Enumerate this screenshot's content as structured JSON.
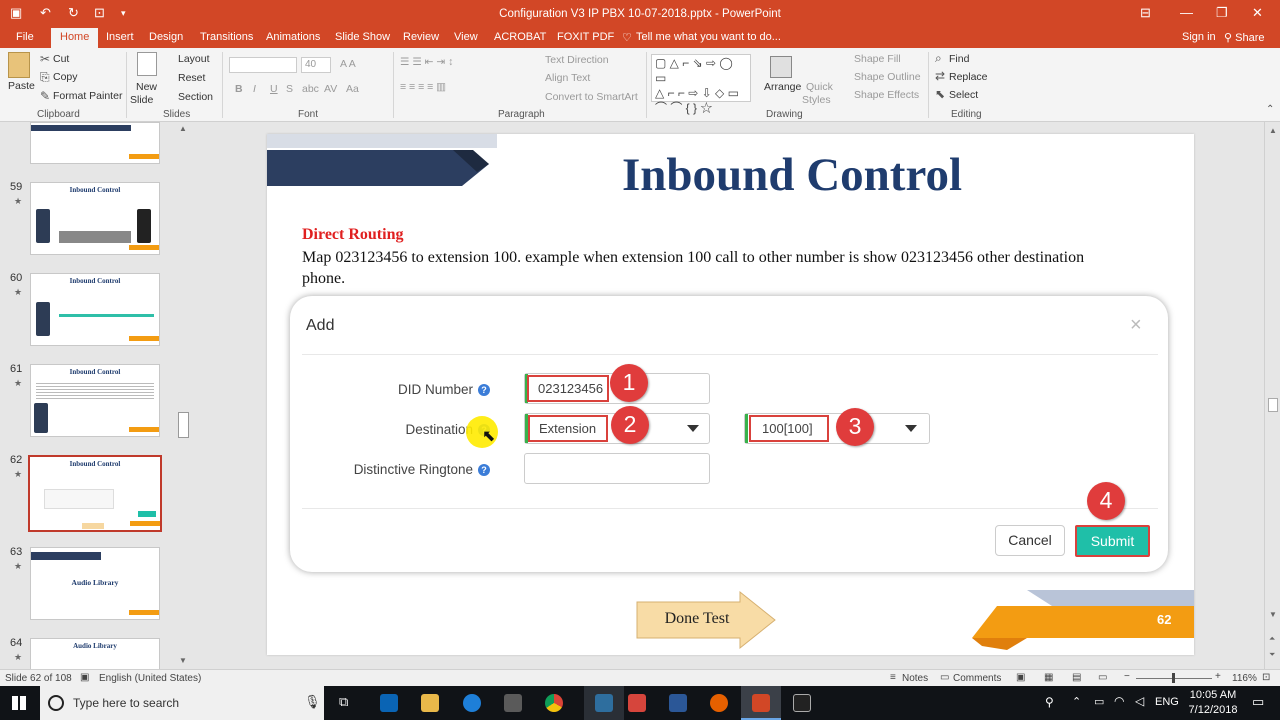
{
  "window": {
    "title": "Configuration V3 IP PBX 10-07-2018.pptx - PowerPoint",
    "sign_in": "Sign in",
    "share": "Share"
  },
  "tabs": [
    "File",
    "Home",
    "Insert",
    "Design",
    "Transitions",
    "Animations",
    "Slide Show",
    "Review",
    "View",
    "ACROBAT",
    "FOXIT PDF"
  ],
  "active_tab": "Home",
  "tell_me": "Tell me what you want to do...",
  "ribbon": {
    "clipboard": {
      "paste": "Paste",
      "cut": "Cut",
      "copy": "Copy",
      "format_painter": "Format Painter",
      "label": "Clipboard"
    },
    "slides": {
      "new_slide_1": "New",
      "new_slide_2": "Slide",
      "layout": "Layout",
      "reset": "Reset",
      "section": "Section",
      "label": "Slides"
    },
    "font": {
      "size": "40",
      "bold": "B",
      "italic": "I",
      "underline": "U",
      "strike": "S",
      "shadow": "abc",
      "spacing": "AV",
      "case": "Aa",
      "label": "Font"
    },
    "paragraph": {
      "text_direction": "Text Direction",
      "align_text": "Align Text",
      "smartart": "Convert to SmartArt",
      "label": "Paragraph"
    },
    "drawing": {
      "arrange": "Arrange",
      "quick_styles_1": "Quick",
      "quick_styles_2": "Styles",
      "shape_fill": "Shape Fill",
      "shape_outline": "Shape Outline",
      "shape_effects": "Shape Effects",
      "label": "Drawing"
    },
    "editing": {
      "find": "Find",
      "replace": "Replace",
      "select": "Select",
      "label": "Editing"
    }
  },
  "thumbnails": [
    {
      "num": "59",
      "title": "Inbound Control"
    },
    {
      "num": "60",
      "title": "Inbound Control"
    },
    {
      "num": "61",
      "title": "Inbound Control"
    },
    {
      "num": "62",
      "title": "Inbound Control",
      "selected": true
    },
    {
      "num": "63",
      "title": "Audio Library",
      "subtitle": "Audio Library"
    },
    {
      "num": "64",
      "title": "Audio Library"
    }
  ],
  "slide": {
    "title": "Inbound Control",
    "heading": "Direct Routing",
    "body": "Map 023123456 to extension 100. example when extension 100 call to other number is show 023123456 other destination phone.",
    "done_button": "Done Test",
    "page_number": "62",
    "dialog": {
      "title": "Add",
      "close": "×",
      "did_label": "DID Number",
      "did_value": "023123456",
      "destination_label": "Destination",
      "destination_type": "Extension",
      "destination_value": "100[100]",
      "ringtone_label": "Distinctive Ringtone",
      "cancel": "Cancel",
      "submit": "Submit",
      "badges": [
        "1",
        "2",
        "3",
        "4"
      ]
    }
  },
  "statusbar": {
    "slide_of": "Slide 62 of 108",
    "language": "English (United States)",
    "notes": "Notes",
    "comments": "Comments",
    "zoom": "116%"
  },
  "taskbar": {
    "search_placeholder": "Type here to search",
    "lang": "ENG",
    "time": "10:05 AM",
    "date": "7/12/2018"
  },
  "colors": {
    "accent": "#d24726",
    "slide_title": "#1f3c6e",
    "heading_red": "#e02020",
    "badge_red": "#e03c3c",
    "submit_teal": "#1fbfa8",
    "orange": "#f39c12"
  }
}
